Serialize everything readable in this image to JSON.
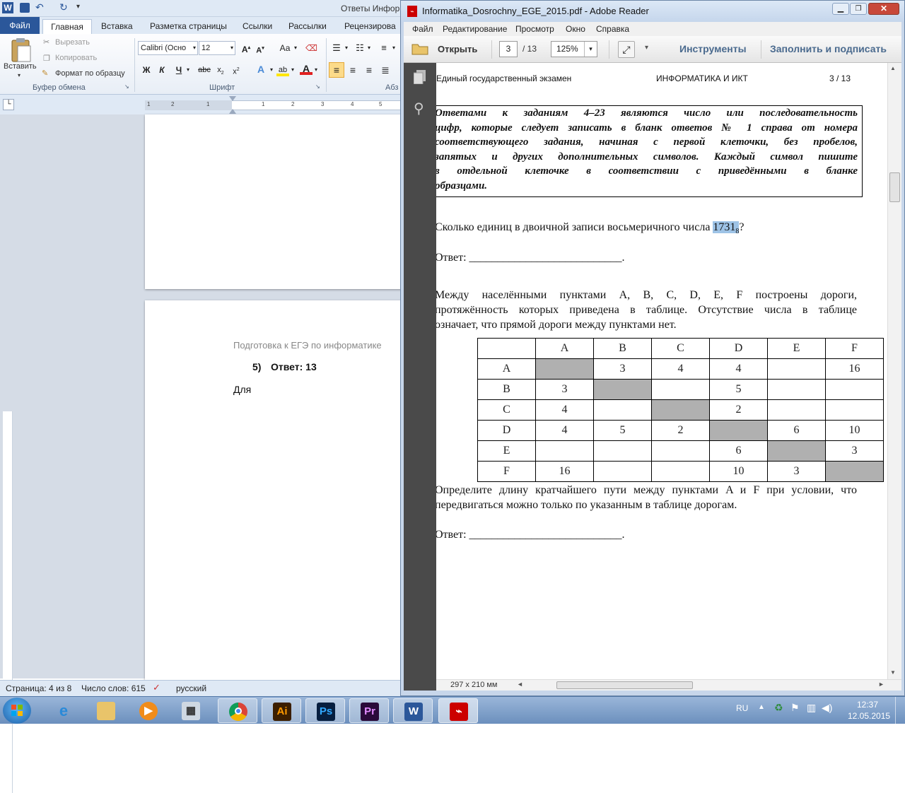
{
  "word": {
    "title": "Ответы Информ",
    "tabs": [
      "Файл",
      "Главная",
      "Вставка",
      "Разметка страницы",
      "Ссылки",
      "Рассылки",
      "Рецензирова"
    ],
    "clipboard": {
      "paste": "Вставить",
      "cut": "Вырезать",
      "copy": "Копировать",
      "format_painter": "Формат по образцу",
      "group": "Буфер обмена"
    },
    "font": {
      "name": "Calibri (Осно",
      "size": "12",
      "group": "Шрифт",
      "aa": "Аа"
    },
    "paragraph_group": "Абз",
    "ruler_numbers": [
      "1",
      "2",
      "1",
      "1",
      "2",
      "3",
      "4",
      "5"
    ],
    "page2": {
      "header": "Подготовка к ЕГЭ по информатике",
      "item_num": "5)",
      "item_text": "Ответ: 13",
      "body": "Для"
    },
    "status": {
      "page": "Страница: 4 из 8",
      "words": "Число слов: 615",
      "lang": "русский"
    }
  },
  "reader": {
    "title": "Informatika_Dosrochny_EGE_2015.pdf - Adobe Reader",
    "menu": [
      "Файл",
      "Редактирование",
      "Просмотр",
      "Окно",
      "Справка"
    ],
    "toolbar": {
      "open": "Открыть",
      "page": "3",
      "page_total": "/ 13",
      "zoom": "125%",
      "tools": "Инструменты",
      "fill_sign": "Заполнить и подписать"
    },
    "page_header": {
      "left": "Единый государственный экзамен",
      "center": "ИНФОРМАТИКА И ИКТ",
      "right": "3 / 13"
    },
    "instruction": [
      "Ответами к заданиям 4–23 являются число или последовательность",
      "цифр, которые следует записать в бланк ответов № 1 справа от номера",
      "соответствующего задания, начиная с первой клеточки, без пробелов,",
      "запятых и других дополнительных символов. Каждый символ пишите",
      "в отдельной клеточке в соответствии с приведёнными в бланке",
      "образцами."
    ],
    "q4": {
      "text": "Сколько единиц в двоичной записи восьмеричного числа ",
      "number": "1731",
      "base": "8",
      "end": "?",
      "answer": "Ответ: ___________________________."
    },
    "q5": {
      "intro": [
        "Между населёнными пунктами A, B, C, D, E, F построены дороги,",
        "протяжённость которых приведена в таблице. Отсутствие числа в таблице",
        "означает, что прямой дороги между пунктами нет."
      ],
      "headers": [
        "",
        "A",
        "B",
        "C",
        "D",
        "E",
        "F"
      ],
      "rows": [
        [
          "A",
          "",
          "3",
          "4",
          "4",
          "",
          "16"
        ],
        [
          "B",
          "3",
          "",
          "",
          "5",
          "",
          ""
        ],
        [
          "C",
          "4",
          "",
          "",
          "2",
          "",
          ""
        ],
        [
          "D",
          "4",
          "5",
          "2",
          "",
          "6",
          "10"
        ],
        [
          "E",
          "",
          "",
          "",
          "6",
          "",
          "3"
        ],
        [
          "F",
          "16",
          "",
          "",
          "10",
          "3",
          ""
        ]
      ],
      "question": [
        "Определите длину кратчайшего пути между пунктами A и F при условии, что",
        "передвигаться можно только по указанным в таблице дорогам."
      ],
      "answer": "Ответ: ___________________________."
    },
    "page_size": "297 x 210 мм"
  },
  "taskbar": {
    "lang": "RU",
    "time": "12:37",
    "date": "12.05.2015"
  }
}
